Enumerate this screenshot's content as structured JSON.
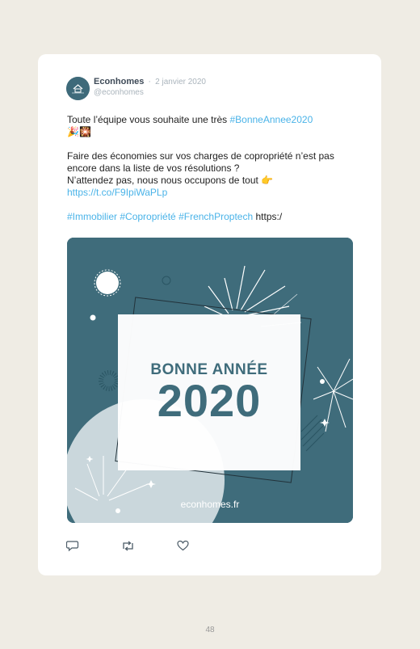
{
  "tweet": {
    "author_name": "Econhomes",
    "separator": "·",
    "date": "2 janvier 2020",
    "handle": "@econhomes",
    "line1_text": "Toute l’équipe vous souhaite une très ",
    "line1_hashtag": "#BonneAnnee2020",
    "line1_emojis": "🎉🎇",
    "para2_text": "Faire des économies sur vos charges de copropriété n’est pas encore dans la liste de vos résolutions ?",
    "para3_text": "N’attendez pas, nous nous occupons de tout ",
    "para3_emoji": "👉",
    "short_link": "https://t.co/F9IpiWaPLp",
    "hashtags": [
      "#Immobilier",
      "#Copropriété",
      "#FrenchProptech"
    ],
    "trailing_text": "https:/"
  },
  "media": {
    "title": "BONNE ANNÉE",
    "year": "2020",
    "site": "econhomes.fr"
  },
  "actions": {
    "reply_icon": "reply-icon",
    "retweet_icon": "retweet-icon",
    "like_icon": "heart-icon"
  },
  "colors": {
    "background": "#efece4",
    "media_teal": "#3f6c7b",
    "link": "#4ab3e8"
  },
  "page_number": "48"
}
